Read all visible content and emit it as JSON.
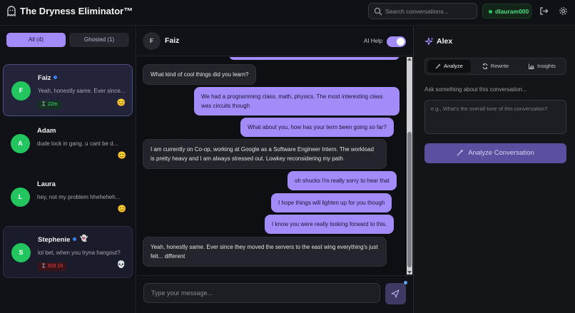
{
  "app": {
    "title": "The Dryness Eliminator™"
  },
  "search": {
    "placeholder": "Search conversations..."
  },
  "user": {
    "name": "dlauram000",
    "status_color": "#22c55e"
  },
  "filters": {
    "all": "All (4)",
    "ghosted": "Ghosted (1)"
  },
  "conversations": [
    {
      "initial": "F",
      "name": "Faiz",
      "snippet": "Yeah, honestly same. Ever since...",
      "badge": "22m",
      "emoji": "😊",
      "active": true
    },
    {
      "initial": "A",
      "name": "Adam",
      "snippet": "dude lock in gang. u cant be d...",
      "badge": "",
      "emoji": "😊"
    },
    {
      "initial": "L",
      "name": "Laura",
      "snippet": "hey, not my problem hheheheh...",
      "badge": "",
      "emoji": "😊"
    },
    {
      "initial": "S",
      "name": "Stephenie",
      "ghost": "👻",
      "snippet": "lol bet, when you tryna hangout?",
      "badge": "92d 1h",
      "emoji": "💀"
    }
  ],
  "chat": {
    "initial": "F",
    "title": "Faiz",
    "ai_help_label": "AI Help",
    "ai_help_on": true,
    "messages": [
      {
        "from": "them",
        "text": "What kind of cool things did you learn?"
      },
      {
        "from": "me",
        "text": "We had a programming class, math, physics. The most interesting class was circuits though"
      },
      {
        "from": "me",
        "text": "What about you, how has your term been going so far?"
      },
      {
        "from": "them",
        "text": "I am currently on Co-op, working at Google as a Software Engineer Intern. The workload is pretty heavy and I am always stressed out. Lowkey reconsidering my path"
      },
      {
        "from": "me",
        "text": "oh shucks I'm really sorry to hear that"
      },
      {
        "from": "me",
        "text": "I hope things will lighten up for you though"
      },
      {
        "from": "me",
        "text": "I know you were really looking forward to this."
      },
      {
        "from": "them",
        "text": "Yeah, honestly same. Ever since they moved the servers to the east wing everything's just felt... different"
      }
    ],
    "composer_placeholder": "Type your message..."
  },
  "assistant": {
    "name": "Alex",
    "tabs": [
      "Analyze",
      "Rewrite",
      "Insights"
    ],
    "active_tab": "Analyze",
    "prompt": "Ask something about this conversation...",
    "placeholder": "e.g., What's the overall tone of this conversation?",
    "button": "Analyze Conversation"
  },
  "colors": {
    "accent": "#a48bfa",
    "online": "#22c55e",
    "ghosted": "#ef4444"
  }
}
